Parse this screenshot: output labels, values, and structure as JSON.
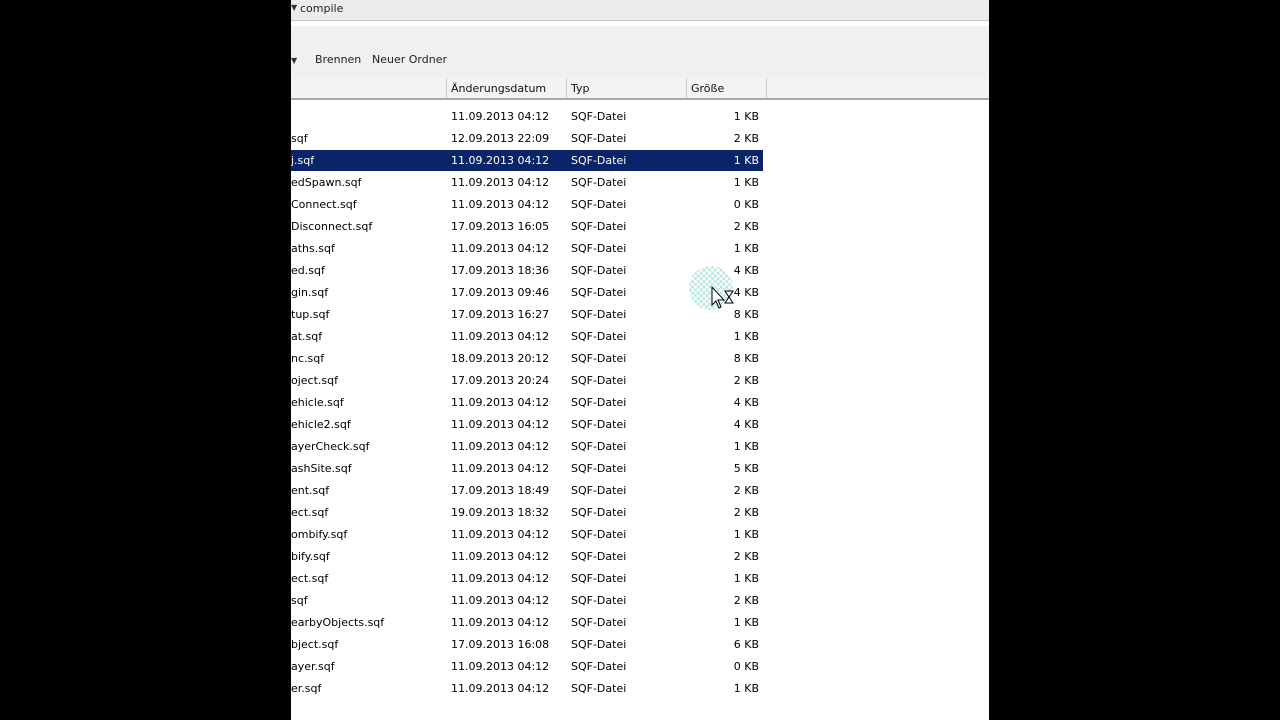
{
  "address": {
    "crumb": "compile"
  },
  "toolbar": {
    "burn_label": "Brennen",
    "new_folder_label": "Neuer Ordner"
  },
  "columns": {
    "date": "Änderungsdatum",
    "type": "Typ",
    "size": "Größe"
  },
  "files": [
    {
      "name": "",
      "date": "11.09.2013 04:12",
      "type": "SQF-Datei",
      "size": "1 KB"
    },
    {
      "name": "sqf",
      "date": "12.09.2013 22:09",
      "type": "SQF-Datei",
      "size": "2 KB"
    },
    {
      "name": "j.sqf",
      "date": "11.09.2013 04:12",
      "type": "SQF-Datei",
      "size": "1 KB",
      "selected": true
    },
    {
      "name": "edSpawn.sqf",
      "date": "11.09.2013 04:12",
      "type": "SQF-Datei",
      "size": "1 KB"
    },
    {
      "name": "Connect.sqf",
      "date": "11.09.2013 04:12",
      "type": "SQF-Datei",
      "size": "0 KB"
    },
    {
      "name": "Disconnect.sqf",
      "date": "17.09.2013 16:05",
      "type": "SQF-Datei",
      "size": "2 KB"
    },
    {
      "name": "aths.sqf",
      "date": "11.09.2013 04:12",
      "type": "SQF-Datei",
      "size": "1 KB"
    },
    {
      "name": "ed.sqf",
      "date": "17.09.2013 18:36",
      "type": "SQF-Datei",
      "size": "4 KB"
    },
    {
      "name": "gin.sqf",
      "date": "17.09.2013 09:46",
      "type": "SQF-Datei",
      "size": "4 KB"
    },
    {
      "name": "tup.sqf",
      "date": "17.09.2013 16:27",
      "type": "SQF-Datei",
      "size": "8 KB"
    },
    {
      "name": "at.sqf",
      "date": "11.09.2013 04:12",
      "type": "SQF-Datei",
      "size": "1 KB"
    },
    {
      "name": "nc.sqf",
      "date": "18.09.2013 20:12",
      "type": "SQF-Datei",
      "size": "8 KB"
    },
    {
      "name": "oject.sqf",
      "date": "17.09.2013 20:24",
      "type": "SQF-Datei",
      "size": "2 KB"
    },
    {
      "name": "ehicle.sqf",
      "date": "11.09.2013 04:12",
      "type": "SQF-Datei",
      "size": "4 KB"
    },
    {
      "name": "ehicle2.sqf",
      "date": "11.09.2013 04:12",
      "type": "SQF-Datei",
      "size": "4 KB"
    },
    {
      "name": "ayerCheck.sqf",
      "date": "11.09.2013 04:12",
      "type": "SQF-Datei",
      "size": "1 KB"
    },
    {
      "name": "ashSite.sqf",
      "date": "11.09.2013 04:12",
      "type": "SQF-Datei",
      "size": "5 KB"
    },
    {
      "name": "ent.sqf",
      "date": "17.09.2013 18:49",
      "type": "SQF-Datei",
      "size": "2 KB"
    },
    {
      "name": "ect.sqf",
      "date": "19.09.2013 18:32",
      "type": "SQF-Datei",
      "size": "2 KB"
    },
    {
      "name": "ombify.sqf",
      "date": "11.09.2013 04:12",
      "type": "SQF-Datei",
      "size": "1 KB"
    },
    {
      "name": "bify.sqf",
      "date": "11.09.2013 04:12",
      "type": "SQF-Datei",
      "size": "2 KB"
    },
    {
      "name": "ect.sqf",
      "date": "11.09.2013 04:12",
      "type": "SQF-Datei",
      "size": "1 KB"
    },
    {
      "name": "sqf",
      "date": "11.09.2013 04:12",
      "type": "SQF-Datei",
      "size": "2 KB"
    },
    {
      "name": "earbyObjects.sqf",
      "date": "11.09.2013 04:12",
      "type": "SQF-Datei",
      "size": "1 KB"
    },
    {
      "name": "bject.sqf",
      "date": "17.09.2013 16:08",
      "type": "SQF-Datei",
      "size": "6 KB"
    },
    {
      "name": "ayer.sqf",
      "date": "11.09.2013 04:12",
      "type": "SQF-Datei",
      "size": "0 KB"
    },
    {
      "name": "er.sqf",
      "date": "11.09.2013 04:12",
      "type": "SQF-Datei",
      "size": "1 KB"
    }
  ]
}
